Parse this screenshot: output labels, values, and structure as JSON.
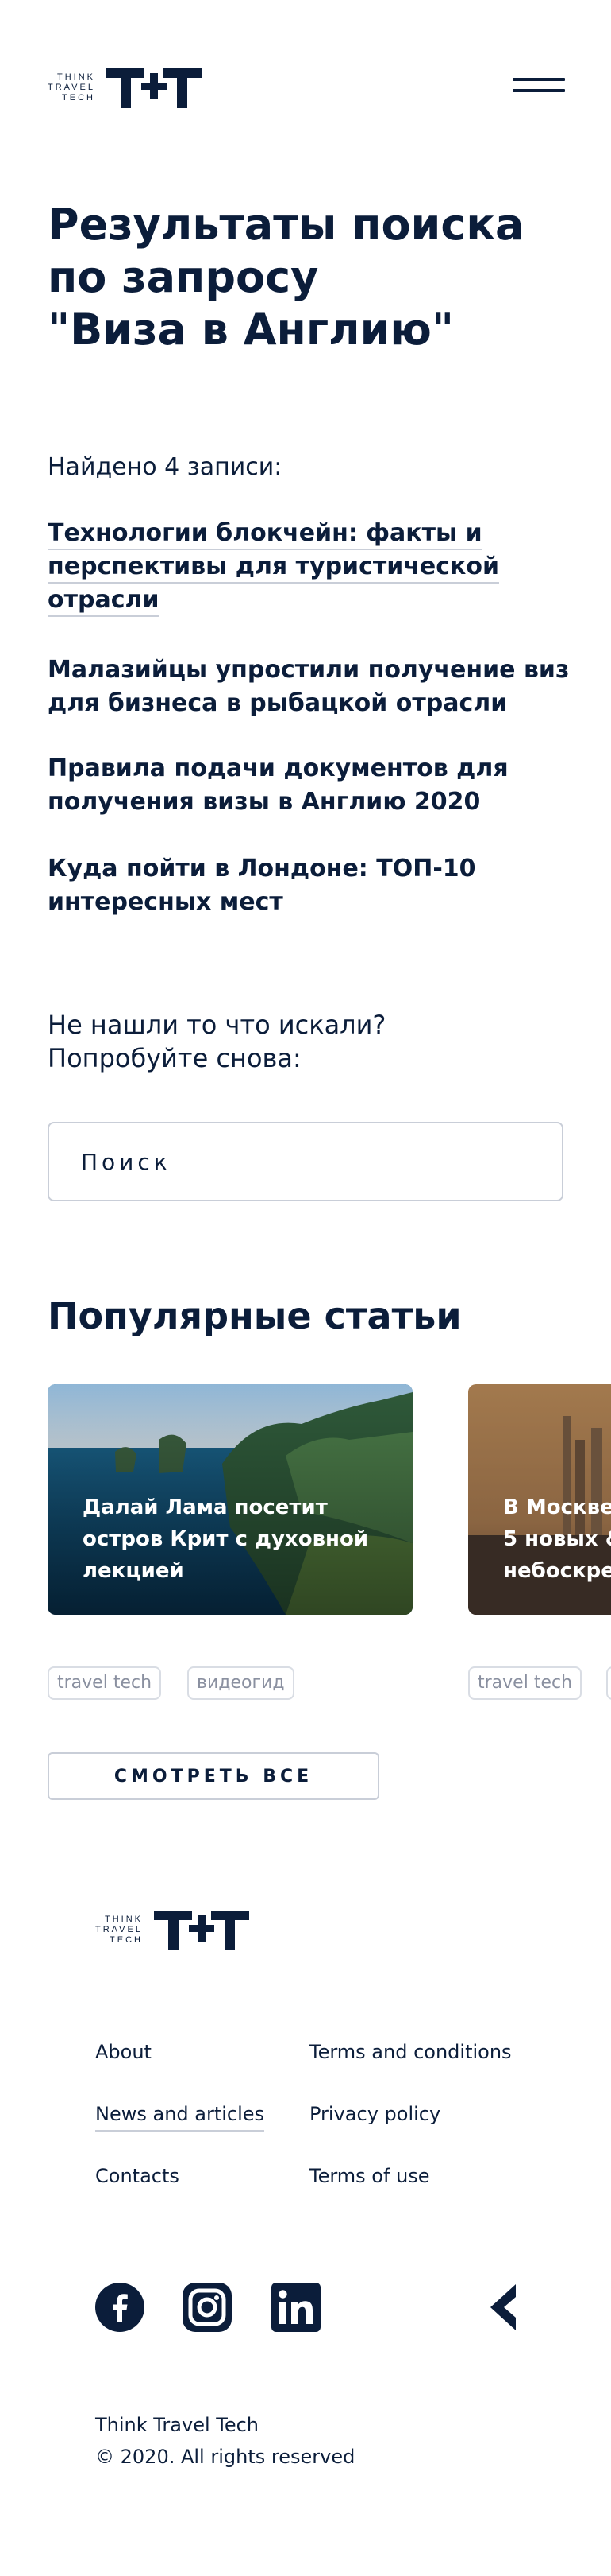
{
  "header": {
    "logo_text": [
      "THINK",
      "TRAVEL",
      "TECH"
    ]
  },
  "page_title_lines": [
    "Результаты поиска",
    "по запросу",
    "\"Виза в Англию\""
  ],
  "results": {
    "found_text": "Найдено 4 записи:",
    "items": [
      {
        "lines": [
          "Технологии блокчейн: факты и",
          "перспективы для туристической",
          "отрасли"
        ]
      },
      {
        "lines": [
          "Малазийцы упростили получение виз",
          "для бизнеса в рыбацкой отрасли"
        ]
      },
      {
        "lines": [
          "Правила подачи документов для",
          "получения визы в Англию 2020"
        ]
      },
      {
        "lines": [
          "Куда пойти в Лондоне: ТОП-10",
          "интересных мест"
        ]
      }
    ]
  },
  "retry": {
    "lines": [
      "Не нашли то что искали?",
      "Попробуйте снова:"
    ],
    "search_placeholder": "Поиск"
  },
  "popular": {
    "title": "Популярные статьи",
    "cards": [
      {
        "title": "Далай Лама посетит остров Крит с духовной лекцией",
        "tags": [
          "travel tech",
          "видеогид"
        ]
      },
      {
        "title": "В Москве 5 новых & небоскре",
        "tags": [
          "travel tech"
        ]
      }
    ],
    "view_all_label": "СМОТРЕТЬ ВСЕ"
  },
  "footer": {
    "logo_text": [
      "THINK",
      "TRAVEL",
      "TECH"
    ],
    "links_left": [
      "About",
      "News and articles",
      "Contacts"
    ],
    "links_right": [
      "Terms and conditions",
      "Privacy policy",
      "Terms of use"
    ],
    "social_icons": [
      "facebook-icon",
      "instagram-icon",
      "linkedin-icon",
      "brand-icon"
    ],
    "company": "Think Travel Tech",
    "copyright": "© 2020. All rights reserved"
  },
  "colors": {
    "navy": "#0b1d3a",
    "border": "#c9ced8"
  }
}
